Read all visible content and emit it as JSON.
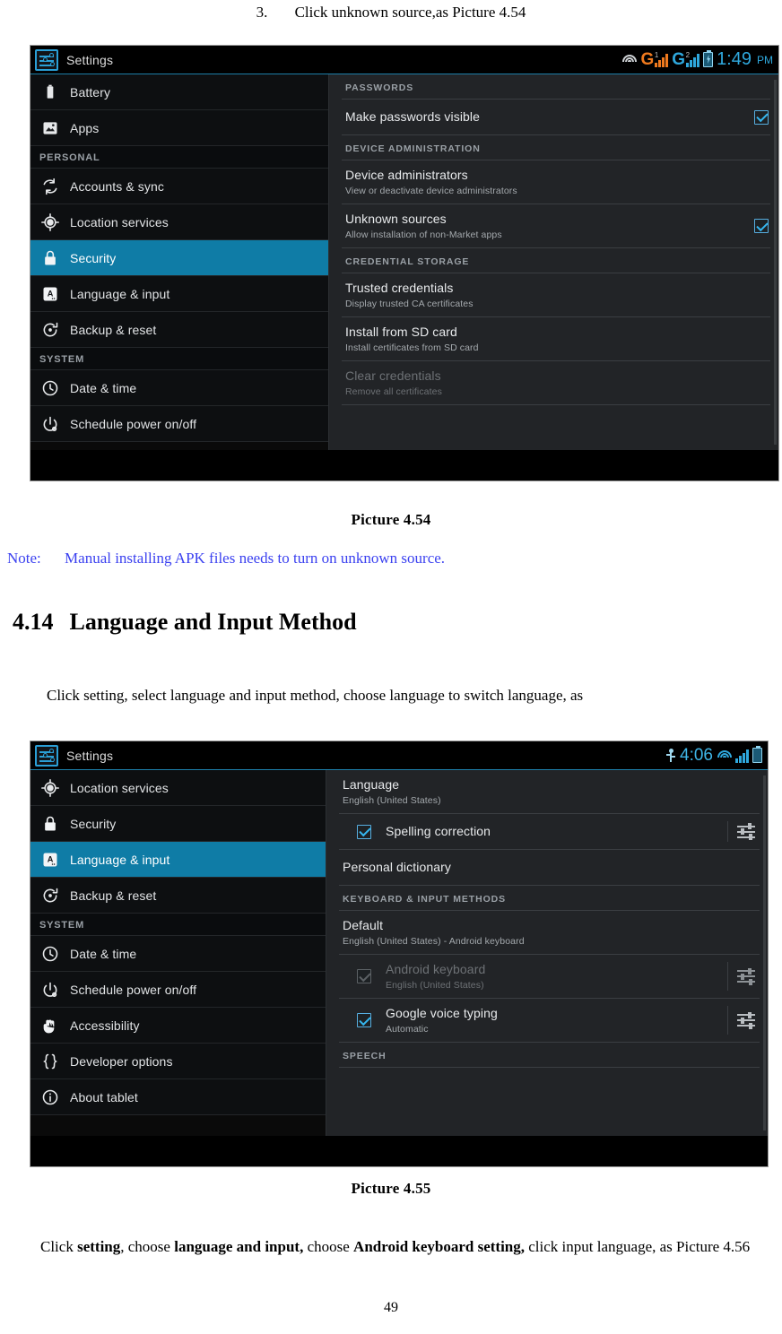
{
  "document": {
    "step": {
      "number": "3.",
      "text": "Click unknown source,as Picture 4.54"
    },
    "caption_1": "Picture 4.54",
    "note": {
      "label": "Note:",
      "text": "Manual installing APK files needs to turn on unknown source."
    },
    "section": {
      "number": "4.14",
      "title": "Language and Input Method"
    },
    "para_1": "Click setting, select language and input method, choose language to switch language, as",
    "caption_2": "Picture 4.55",
    "para_2": {
      "p1": "Click ",
      "b1": "setting",
      "p2": ", choose ",
      "b2": "language and input,",
      "p3": " choose ",
      "b3": "Android keyboard setting,",
      "p4": " click input language, as Picture 4.56"
    },
    "page_number": "49"
  },
  "colors": {
    "accent_blue": "#0f7ca6",
    "checkbox_blue": "#35b6ef",
    "status_orange": "#f07a1e",
    "status_cyan": "#2fa8dd",
    "note_blue": "#3b41f0",
    "content_bg": "#222427",
    "sidebar_bg": "#0d0f11"
  },
  "screenshot_security": {
    "statusbar": {
      "app_title": "Settings",
      "app_icon": "settings-sliders-icon",
      "icons": [
        "wifi-icon",
        "signal-g-orange-icon",
        "signal-g-blue-icon",
        "battery-charging-icon"
      ],
      "signal_1_letter": "G",
      "signal_1_sup": "1",
      "signal_2_letter": "G",
      "signal_2_sup": "2",
      "time": "1:49",
      "ampm": "PM"
    },
    "sidebar": [
      {
        "label": "Battery",
        "icon": "battery-icon",
        "type": "item",
        "selected": false,
        "partial": true
      },
      {
        "label": "Apps",
        "icon": "apps-icon",
        "type": "item",
        "selected": false
      },
      {
        "label": "PERSONAL",
        "type": "group"
      },
      {
        "label": "Accounts & sync",
        "icon": "sync-icon",
        "type": "item",
        "selected": false
      },
      {
        "label": "Location services",
        "icon": "location-icon",
        "type": "item",
        "selected": false
      },
      {
        "label": "Security",
        "icon": "lock-icon",
        "type": "item",
        "selected": true
      },
      {
        "label": "Language & input",
        "icon": "language-icon",
        "type": "item",
        "selected": false
      },
      {
        "label": "Backup & reset",
        "icon": "backup-icon",
        "type": "item",
        "selected": false
      },
      {
        "label": "SYSTEM",
        "type": "group"
      },
      {
        "label": "Date & time",
        "icon": "clock-icon",
        "type": "item",
        "selected": false
      },
      {
        "label": "Schedule power on/off",
        "icon": "power-icon",
        "type": "item",
        "selected": false
      }
    ],
    "content": [
      {
        "type": "group",
        "label": "PASSWORDS"
      },
      {
        "type": "row",
        "title": "Make passwords visible",
        "sub": "",
        "checkbox": "on",
        "checkbox_side": "right",
        "dim": false
      },
      {
        "type": "group",
        "label": "DEVICE ADMINISTRATION"
      },
      {
        "type": "row",
        "title": "Device administrators",
        "sub": "View or deactivate device administrators",
        "checkbox": "none",
        "dim": false
      },
      {
        "type": "row",
        "title": "Unknown sources",
        "sub": "Allow installation of non-Market apps",
        "checkbox": "on",
        "checkbox_side": "right",
        "dim": false
      },
      {
        "type": "group",
        "label": "CREDENTIAL STORAGE"
      },
      {
        "type": "row",
        "title": "Trusted credentials",
        "sub": "Display trusted CA certificates",
        "checkbox": "none",
        "dim": false
      },
      {
        "type": "row",
        "title": "Install from SD card",
        "sub": "Install certificates from SD card",
        "checkbox": "none",
        "dim": false
      },
      {
        "type": "row",
        "title": "Clear credentials",
        "sub": "Remove all certificates",
        "checkbox": "none",
        "dim": true
      }
    ]
  },
  "screenshot_language": {
    "statusbar": {
      "app_title": "Settings",
      "app_icon": "settings-sliders-icon",
      "icons": [
        "usb-icon",
        "wifi-icon",
        "signal-icon",
        "battery-icon"
      ],
      "time": "4:06",
      "ampm": ""
    },
    "sidebar": [
      {
        "label": "Location services",
        "icon": "location-icon",
        "type": "item",
        "selected": false
      },
      {
        "label": "Security",
        "icon": "lock-icon",
        "type": "item",
        "selected": false
      },
      {
        "label": "Language & input",
        "icon": "language-icon",
        "type": "item",
        "selected": true
      },
      {
        "label": "Backup & reset",
        "icon": "backup-icon",
        "type": "item",
        "selected": false
      },
      {
        "label": "SYSTEM",
        "type": "group"
      },
      {
        "label": "Date & time",
        "icon": "clock-icon",
        "type": "item",
        "selected": false
      },
      {
        "label": "Schedule power on/off",
        "icon": "power-icon",
        "type": "item",
        "selected": false
      },
      {
        "label": "Accessibility",
        "icon": "hand-icon",
        "type": "item",
        "selected": false
      },
      {
        "label": "Developer options",
        "icon": "braces-icon",
        "type": "item",
        "selected": false
      },
      {
        "label": "About tablet",
        "icon": "info-icon",
        "type": "item",
        "selected": false
      }
    ],
    "content": [
      {
        "type": "row",
        "title": "Language",
        "sub": "English (United States)",
        "checkbox": "none",
        "dim": false
      },
      {
        "type": "row",
        "title": "Spelling correction",
        "sub": "",
        "checkbox": "on",
        "checkbox_side": "left",
        "settings_icon": true,
        "indent": true,
        "dim": false
      },
      {
        "type": "row",
        "title": "Personal dictionary",
        "sub": "",
        "checkbox": "none",
        "dim": false
      },
      {
        "type": "group",
        "label": "KEYBOARD & INPUT METHODS"
      },
      {
        "type": "row",
        "title": "Default",
        "sub": "English (United States) - Android keyboard",
        "checkbox": "none",
        "dim": false
      },
      {
        "type": "row",
        "title": "Android keyboard",
        "sub": "English (United States)",
        "checkbox": "off",
        "checkbox_side": "left",
        "settings_icon": true,
        "indent": true,
        "dim": true
      },
      {
        "type": "row",
        "title": "Google voice typing",
        "sub": "Automatic",
        "checkbox": "on",
        "checkbox_side": "left",
        "settings_icon": true,
        "indent": true,
        "dim": false
      },
      {
        "type": "group",
        "label": "SPEECH"
      }
    ]
  }
}
